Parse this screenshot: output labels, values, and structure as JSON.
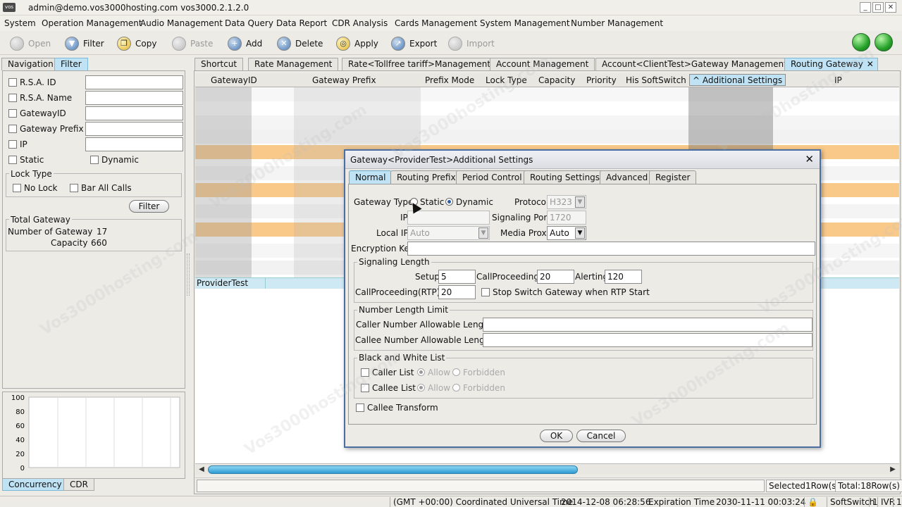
{
  "window": {
    "title": "admin@demo.vos3000hosting.com vos3000.2.1.2.0",
    "logo": "vos"
  },
  "menu": [
    "System",
    "Operation Management",
    "Audio Management",
    "Data Query",
    "Data Report",
    "CDR Analysis",
    "Cards Management",
    "System Management",
    "Number Management"
  ],
  "toolbar": {
    "open": "Open",
    "filter": "Filter",
    "copy": "Copy",
    "paste": "Paste",
    "add": "Add",
    "delete": "Delete",
    "apply": "Apply",
    "export": "Export",
    "import": "Import"
  },
  "left_tabs": {
    "navigation": "Navigation",
    "filter": "Filter"
  },
  "filter": {
    "rsa_id": "R.S.A. ID",
    "rsa_name": "R.S.A. Name",
    "gateway_id": "GatewayID",
    "gateway_prefix": "Gateway Prefix",
    "ip": "IP",
    "static": "Static",
    "dynamic": "Dynamic",
    "lock_type": "Lock Type",
    "no_lock": "No Lock",
    "bar_all_calls": "Bar All Calls",
    "filter_button": "Filter",
    "total_gateway": "Total Gateway",
    "number_of_gateway_label": "Number of Gateway",
    "number_of_gateway": "17",
    "capacity_label": "Capacity",
    "capacity": "660"
  },
  "chart": {
    "y_ticks": [
      "100",
      "80",
      "60",
      "40",
      "20",
      "0"
    ]
  },
  "bottom_tabs": {
    "concurrency": "Concurrency",
    "cdr": "CDR"
  },
  "content_tabs": [
    "Shortcut",
    "Rate Management",
    "Rate<Tollfree tariff>Management",
    "Account Management",
    "Account<ClientTest>Gateway Management",
    "Routing Gateway"
  ],
  "grid": {
    "columns": [
      "GatewayID",
      "Gateway Prefix",
      "Prefix Mode",
      "Lock Type",
      "Capacity",
      "Priority",
      "His SoftSwitch",
      "^ Additional Settings",
      "IP"
    ],
    "selected_row": "ProviderTest"
  },
  "status": {
    "selected": "Selected1Row(s)",
    "total": "Total:18Row(s)"
  },
  "bottombar": {
    "timezone": "(GMT +00:00) Coordinated Universal Time",
    "datetime": "2014-12-08 06:28:56",
    "expiration_label": "Expiration Time",
    "expiration": "2030-11-11 00:03:24",
    "softswitch": "SoftSwitch",
    "ss_count": "1",
    "ivr": "IVR",
    "ivr_count": "1"
  },
  "dialog": {
    "title": "Gateway<ProviderTest>Additional Settings",
    "tabs": [
      "Normal",
      "Routing Prefix",
      "Period Control",
      "Routing Settings",
      "Advanced",
      "Register"
    ],
    "gateway_type": "Gateway Type",
    "static": "Static",
    "dynamic": "Dynamic",
    "protocol_label": "Protocol",
    "protocol": "H323",
    "ip_label": "IP",
    "ip": "",
    "signaling_port_label": "Signaling Port",
    "signaling_port": "1720",
    "local_ip_label": "Local IP",
    "local_ip": "Auto",
    "media_proxy_label": "Media Proxy",
    "media_proxy": "Auto",
    "encryption_key_label": "Encryption Key",
    "encryption_key": "",
    "signaling_length": "Signaling Length",
    "setup_label": "Setup",
    "setup": "5",
    "callproceeding_label": "CallProceeding",
    "callproceeding": "20",
    "alerting_label": "Alerting",
    "alerting": "120",
    "cp_rtp_label": "CallProceeding(RTP)",
    "cp_rtp": "20",
    "stop_switch": "Stop Switch Gateway when RTP Start",
    "number_length_limit": "Number Length Limit",
    "caller_len_label": "Caller Number Allowable Length",
    "callee_len_label": "Callee Number Allowable Length",
    "bw_list": "Black and White List",
    "caller_list": "Caller List",
    "callee_list": "Callee List",
    "allow": "Allow",
    "forbidden": "Forbidden",
    "callee_transform": "Callee Transform",
    "ok": "OK",
    "cancel": "Cancel"
  },
  "watermark": "Vos3000hosting.com"
}
